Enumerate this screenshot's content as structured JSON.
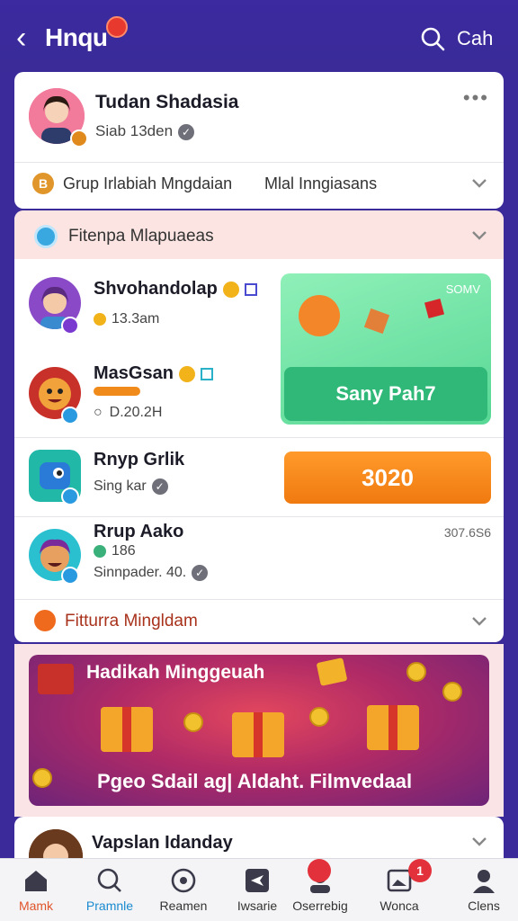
{
  "header": {
    "title": "Hnqu",
    "search_label": "Cah"
  },
  "profile": {
    "name": "Tudan Shadasia",
    "subtitle": "Siab 13den",
    "group_label": "Grup Irlabiah Mngdaian",
    "group_label_2": "Mlal Inngiasans"
  },
  "features": {
    "title": "Fitenpa Mlapuaeas",
    "items": [
      {
        "name": "Shvohandolap",
        "sub": "13.3am"
      },
      {
        "name": "MasGsan",
        "sub": "D.20.2H"
      },
      {
        "name": "Rnyp Grlik",
        "sub": "Sing kar"
      },
      {
        "name": "Rrup Aako",
        "sub_prefix": "186",
        "sub": "Sinnpader. 40."
      }
    ],
    "promo": {
      "count": "SOMV",
      "button": "Sany Pah7"
    },
    "orange_button": "3020",
    "time_label": "307.6S6",
    "footer_label": "Fitturra Mingldam"
  },
  "banner": {
    "title": "Hadikah Minggeuah",
    "text": "Pgeo Sdail ag| Aldaht. Filmvedaal"
  },
  "peek": {
    "name": "Vapslan Idanday"
  },
  "nav": {
    "items": [
      {
        "label": "Mamk"
      },
      {
        "label": "Pramnle"
      },
      {
        "label": "Reamen"
      },
      {
        "label": "Iwsarie"
      },
      {
        "label": "Oserrebig",
        "badge": ""
      },
      {
        "label": "Wonca",
        "badge": "1"
      },
      {
        "label": "Clens"
      }
    ]
  },
  "colors": {
    "primary": "#3a2a9a",
    "accent_green": "#2fb877",
    "accent_orange": "#f07a10",
    "badge_red": "#e2313a"
  }
}
